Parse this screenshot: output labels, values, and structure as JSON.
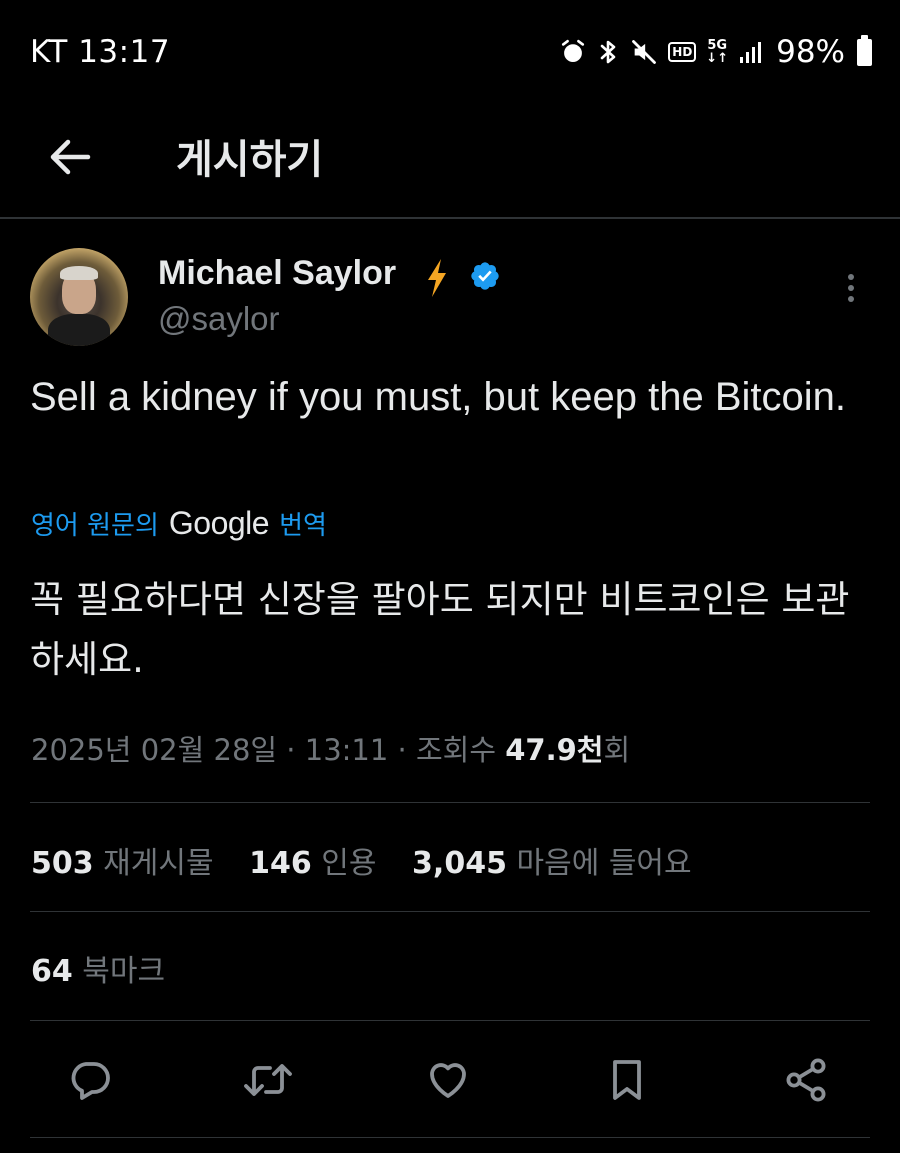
{
  "status_bar": {
    "carrier_time": "KT 13:17",
    "hd_label": "HD",
    "network_label": "5G",
    "battery": "98%"
  },
  "header": {
    "title": "게시하기"
  },
  "tweet": {
    "display_name": "Michael Saylor",
    "handle": "@saylor",
    "text": "Sell a kidney if you must, but keep the Bitcoin.",
    "translation_prefix": "영어 원문의",
    "translation_brand": "Google",
    "translation_suffix": "번역",
    "translated_text": "꼭 필요하다면 신장을 팔아도 되지만 비트코인은 보관하세요.",
    "date": "2025년 02월 28일 · 13:11 · 조회수",
    "views_number": "47.9천",
    "views_unit": "회"
  },
  "stats": {
    "reposts_count": "503",
    "reposts_label": "재게시물",
    "quotes_count": "146",
    "quotes_label": "인용",
    "likes_count": "3,045",
    "likes_label": "마음에 들어요",
    "bookmarks_count": "64",
    "bookmarks_label": "북마크"
  },
  "colors": {
    "background": "#000000",
    "text": "#e7e9ea",
    "muted": "#71767b",
    "accent": "#1d9bf0",
    "lightning": "#f5a623"
  },
  "icons": {
    "back": "arrow-left-icon",
    "lightning": "lightning-icon",
    "verified": "verified-badge-icon",
    "more": "more-vertical-icon",
    "reply": "reply-icon",
    "repost": "repost-icon",
    "like": "heart-icon",
    "bookmark": "bookmark-icon",
    "share": "share-icon"
  }
}
